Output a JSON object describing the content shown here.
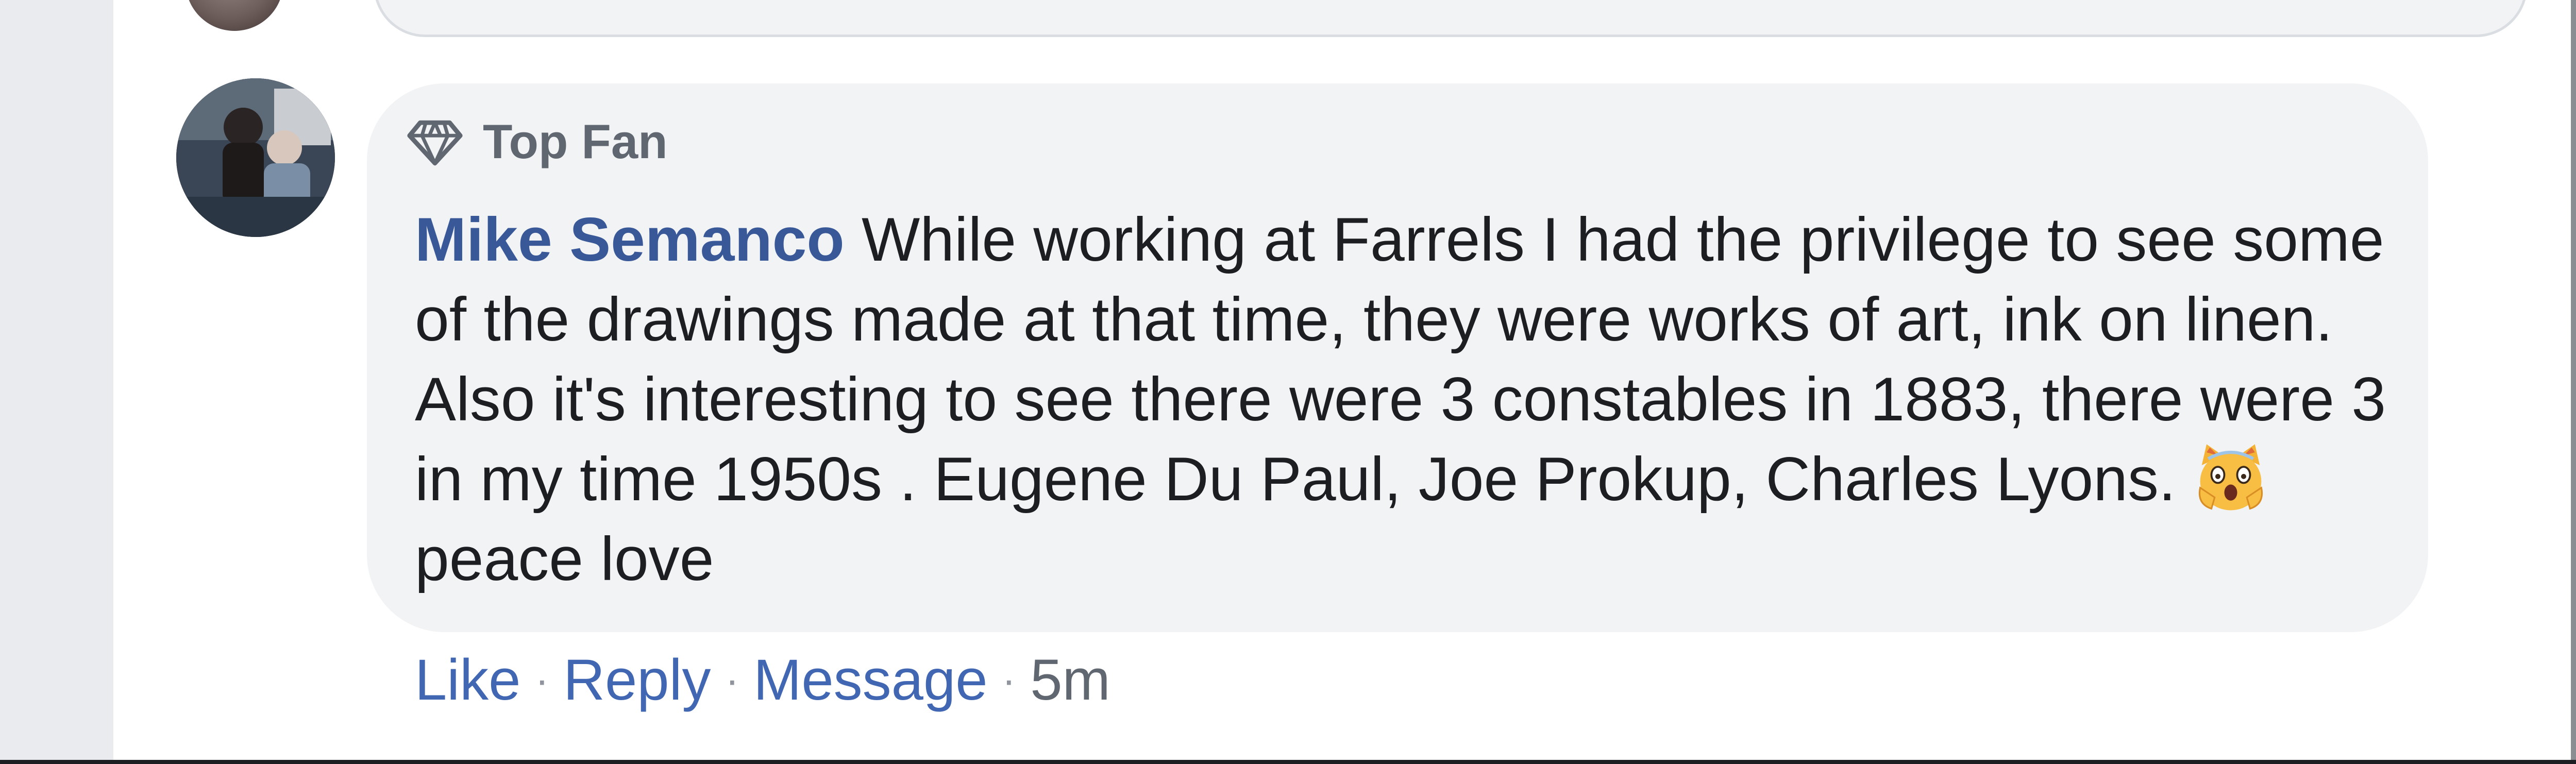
{
  "comment": {
    "badge": {
      "icon": "diamond-icon",
      "label": "Top Fan"
    },
    "author": "Mike Semanco",
    "text_part1": " While working at Farrels I had the privilege to see some of the drawings made at that time, they were works of art, ink on linen. Also it's interesting to see there were 3 constables in 1883, there were 3 in my time 1950s . Eugene Du Paul, Joe Prokup, Charles Lyons.",
    "emoji": "face-screaming-in-fear-icon",
    "text_part2": "peace love",
    "actions": {
      "like": "Like",
      "reply": "Reply",
      "message": "Message",
      "separator": "·",
      "timestamp": "5m"
    }
  },
  "colors": {
    "author": "#385898",
    "action_link": "#4267b2",
    "bubble": "#f2f3f5",
    "gutter": "#e9ebee"
  }
}
